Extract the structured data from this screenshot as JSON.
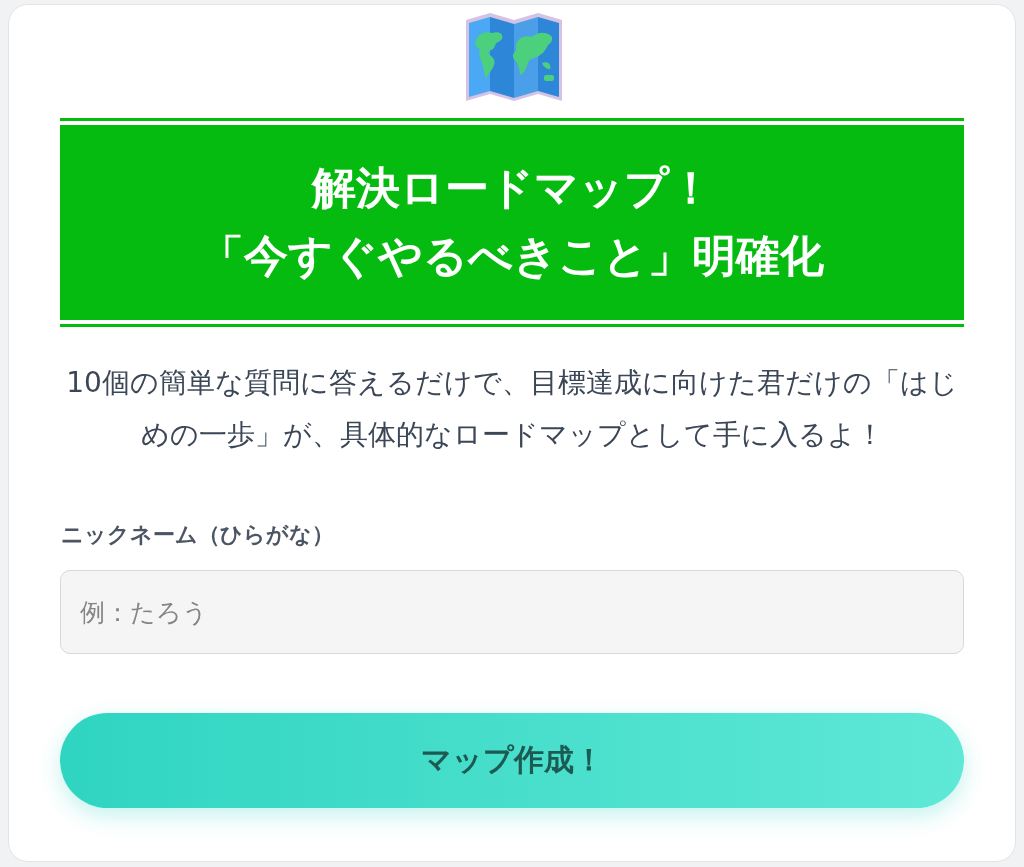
{
  "banner": {
    "title_lines": [
      "解決ロードマップ！",
      "「今すぐやるべきこと」明確化"
    ]
  },
  "intro": "10個の簡単な質問に答えるだけで、目標達成に向けた君だけの「はじめの一歩」が、具体的なロードマップとして手に入るよ！",
  "form": {
    "fields": [
      {
        "label": "ニックネーム（ひらがな）",
        "placeholder": "例：たろう"
      }
    ],
    "submit": "マップ作成！"
  }
}
